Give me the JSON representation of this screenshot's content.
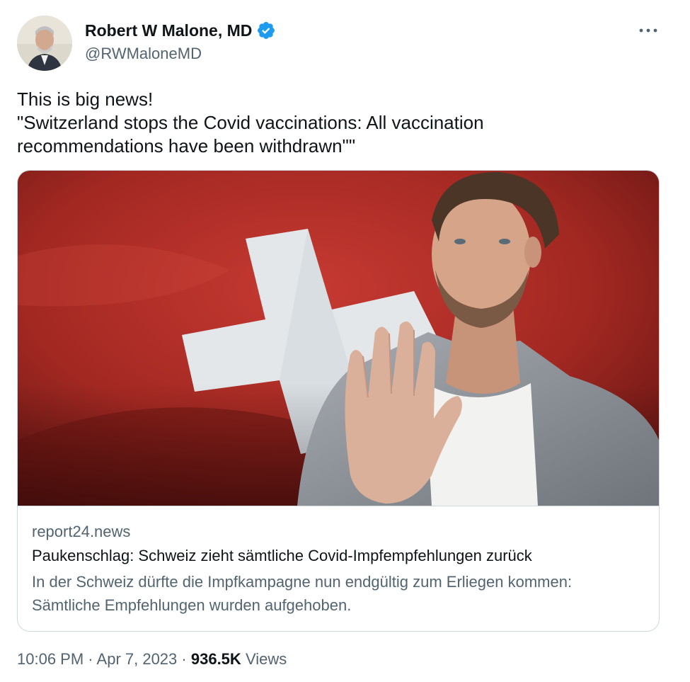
{
  "author": {
    "display_name": "Robert W Malone, MD",
    "handle": "@RWMaloneMD",
    "verified": true,
    "verified_color": "#1d9bf0"
  },
  "menu": {
    "icon": "more-horizontal-icon"
  },
  "tweet": {
    "lines": [
      "This is big news!",
      "\"Switzerland stops the Covid vaccinations: All vaccination",
      "recommendations have been withdrawn\"\""
    ]
  },
  "card": {
    "domain": "report24.news",
    "title": "Paukenschlag: Schweiz zieht sämtliche Covid-Impfempfehlungen zurück",
    "description_lines": [
      "In der Schweiz dürfte die Impfkampagne nun endgültig zum Erliegen kommen:",
      "Sämtliche Empfehlungen wurden aufgehoben."
    ]
  },
  "meta": {
    "time": "10:06 PM",
    "separator": "·",
    "date": "Apr 7, 2023",
    "views_count": "936.5K",
    "views_label": "Views"
  },
  "colors": {
    "text_primary": "#0f1419",
    "text_secondary": "#536471",
    "border": "#cfd9de",
    "flag_red": "#b8322c"
  }
}
